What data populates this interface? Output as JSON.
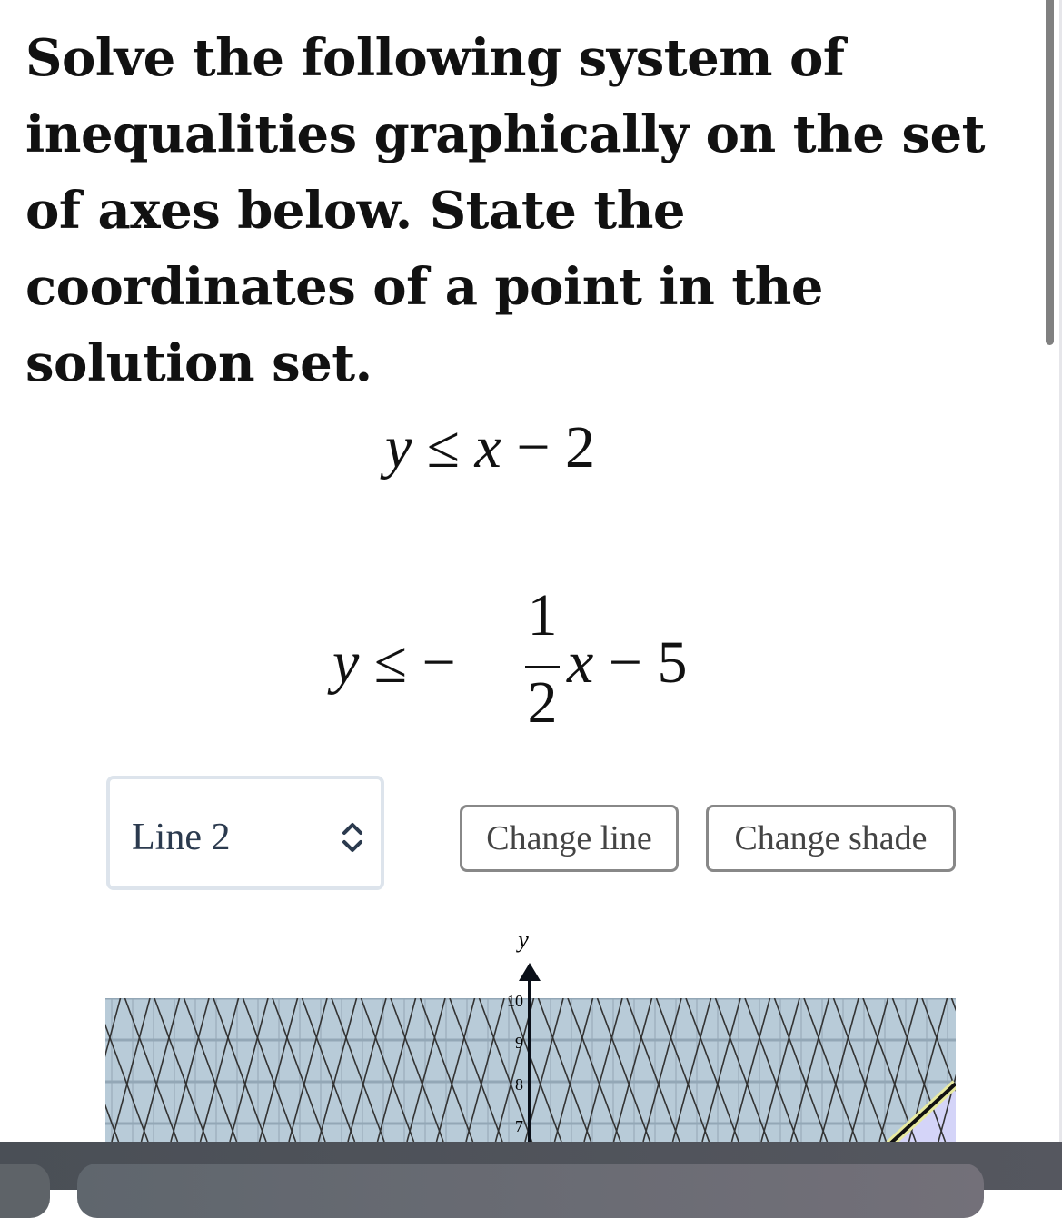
{
  "question": "Solve the following system of inequalities graphically on the set of axes below. State the coordinates of a point in the solution set.",
  "inequalities": {
    "first": {
      "lhs": "y",
      "op": "≤",
      "rhs_var": "x",
      "rhs_const": "− 2"
    },
    "second": {
      "lhs": "y",
      "op": "≤ −",
      "numerator": "1",
      "denominator": "2",
      "rhs_var": "x",
      "rhs_const": "− 5"
    }
  },
  "controls": {
    "line_select": {
      "value": "Line 2"
    },
    "change_line_label": "Change line",
    "change_shade_label": "Change shade"
  },
  "graph": {
    "y_axis_label": "y",
    "y_tick_labels": [
      "10",
      "9",
      "8",
      "7"
    ],
    "colors": {
      "shade": "#b8cbd8",
      "line2_region": "#d4d4f8",
      "line_highlight": "#e8eaa0",
      "hatch": "#333333"
    }
  }
}
